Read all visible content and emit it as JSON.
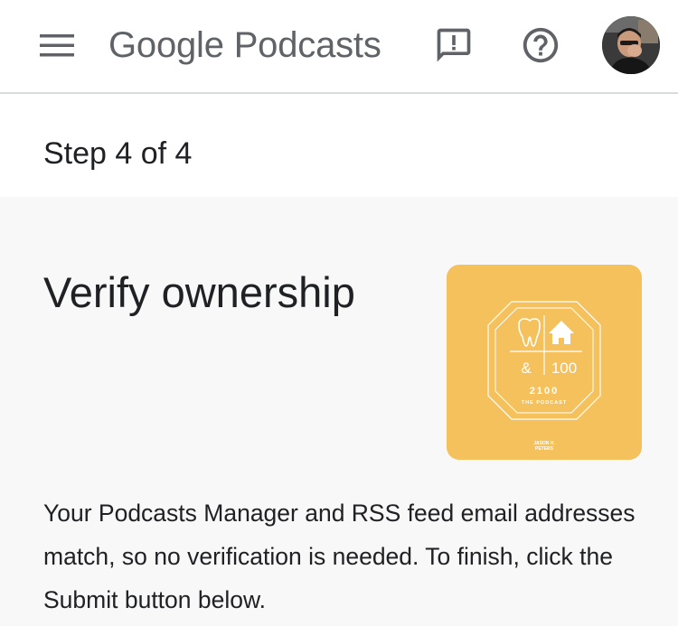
{
  "header": {
    "app_title": "Google Podcasts",
    "icons": {
      "menu": "menu-icon",
      "feedback": "feedback-icon",
      "help": "help-icon",
      "avatar": "user-avatar"
    }
  },
  "stepper": {
    "label": "Step 4 of 4"
  },
  "main": {
    "title": "Verify ownership",
    "description": "Your Podcasts Manager and RSS feed email addresses match, so no verification is needed. To finish, click the Submit button below.",
    "artwork": {
      "ampersand": "&",
      "number": "100",
      "show_number": "2100",
      "show_subtitle": "THE PODCAST",
      "host_name_line1": "JASON H.",
      "host_name_line2": "PETERS"
    }
  },
  "colors": {
    "artwork_background": "#f4c15d",
    "icon_gray": "#5f6368",
    "text_primary": "#202124"
  }
}
